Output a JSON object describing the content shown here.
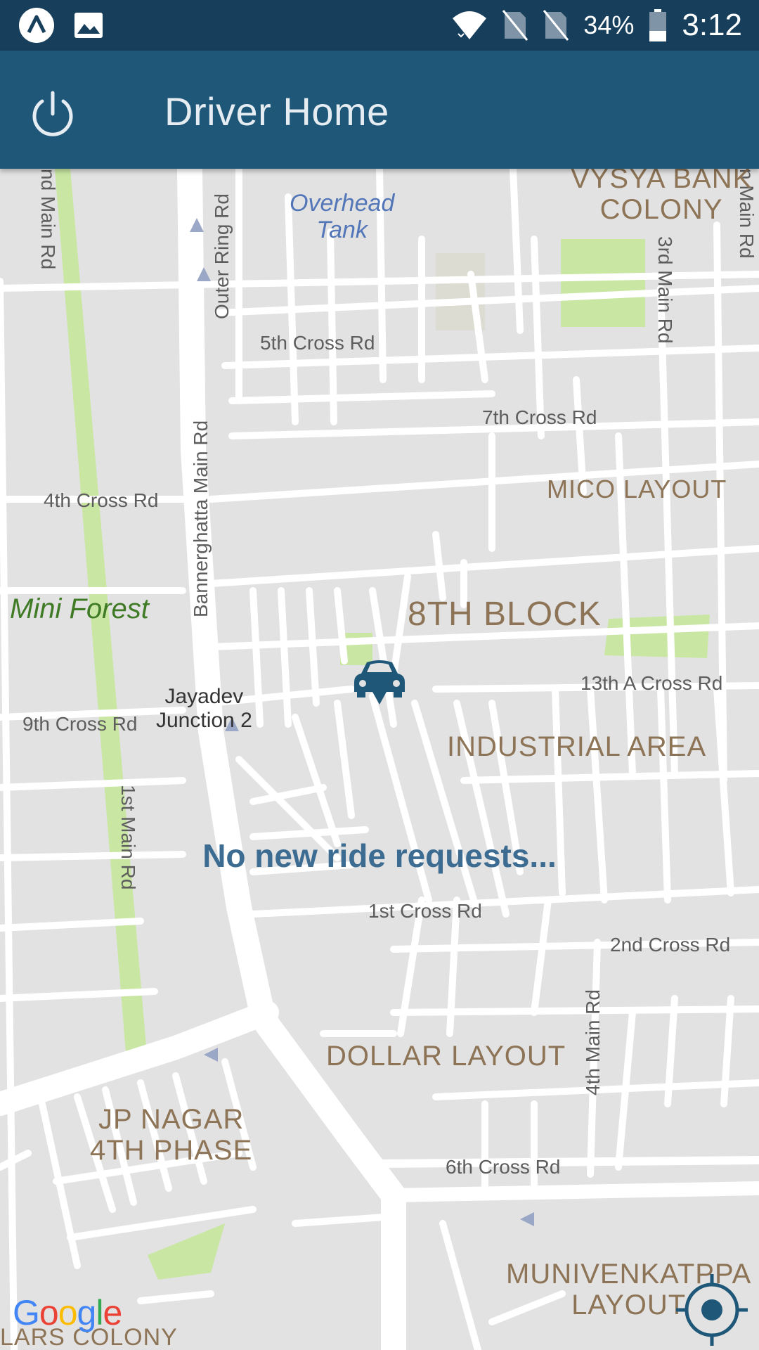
{
  "status_bar": {
    "battery": "34%",
    "time": "3:12",
    "icons": [
      "app-icon",
      "image-icon",
      "wifi-icon",
      "no-sim-icon",
      "no-sim-icon",
      "battery-icon"
    ]
  },
  "app_bar": {
    "title": "Driver Home",
    "power_icon": "power-icon"
  },
  "map": {
    "streets": {
      "main_rd_top": "nd Main Rd",
      "outer_ring_rd": "Outer Ring Rd",
      "fifth_cross": "5th Cross Rd",
      "seventh_cross": "7th Cross Rd",
      "fourth_cross": "4th Cross Rd",
      "bannerghatta": "Bannerghatta Main Rd",
      "thirteen_a_cross": "13th A Cross Rd",
      "ninth_cross": "9th Cross Rd",
      "first_main": "1st Main Rd",
      "first_cross": "1st Cross Rd",
      "second_cross": "2nd Cross Rd",
      "fourth_main": "4th Main Rd",
      "sixth_cross": "6th Cross Rd",
      "third_main": "3rd Main Rd",
      "right_edge_main": "n Main Rd"
    },
    "areas": {
      "vysya": "VYSYA BANK\nCOLONY",
      "mico": "MICO LAYOUT",
      "eighth_block": "8TH BLOCK",
      "industrial": "INDUSTRIAL AREA",
      "dollar": "DOLLAR LAYOUT",
      "jp_nagar": "JP NAGAR\n4TH PHASE",
      "munivenkatppa": "MUNIVENKATPPA\nLAYOUT",
      "lars": "LARS COLONY"
    },
    "pois": {
      "overhead_tank": "Overhead\nTank",
      "mini_forest": "Mini Forest",
      "jayadev": "Jayadev\nJunction 2"
    },
    "attribution": "Google"
  },
  "message": "No new ride requests...",
  "colors": {
    "status_bar": "#173e5b",
    "app_bar": "#1f5779",
    "accent": "#1f5779",
    "message": "#3c6c92"
  }
}
